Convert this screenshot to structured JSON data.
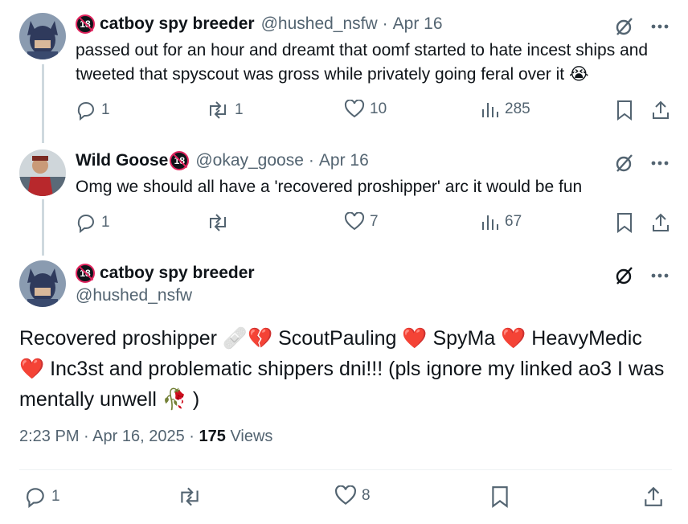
{
  "thread": [
    {
      "name": "catboy spy breeder",
      "handle": "@hushed_nsfw",
      "dot": "·",
      "date": "Apr 16",
      "text": "passed out for an hour and dreamt that oomf started to hate incest ships and tweeted that spyscout was gross while privately going feral over it 😭",
      "replies": "1",
      "retweets": "1",
      "likes": "10",
      "views": "285"
    },
    {
      "name": "Wild Goose",
      "handle": "@okay_goose",
      "dot": "·",
      "date": "Apr 16",
      "text": "Omg we should all have a 'recovered proshipper' arc it would be fun",
      "replies": "1",
      "retweets": "",
      "likes": "7",
      "views": "67"
    }
  ],
  "main": {
    "name": "catboy spy breeder",
    "handle": "@hushed_nsfw",
    "text": "Recovered proshipper 🩹💔 ScoutPauling ❤️ SpyMa ❤️ HeavyMedic ❤️ Inc3st and problematic shippers dni!!! (pls ignore my linked ao3 I was mentally unwell 🥀 )",
    "time": "2:23 PM",
    "dot": "·",
    "date": "Apr 16, 2025",
    "views_count": "175",
    "views_label": "Views",
    "replies": "1",
    "retweets": "",
    "likes": "8"
  },
  "badge_text": "18",
  "colors": {
    "text": "#0f1419",
    "secondary": "#536471",
    "line": "#cfd9de",
    "badge_red": "#e0245e"
  }
}
